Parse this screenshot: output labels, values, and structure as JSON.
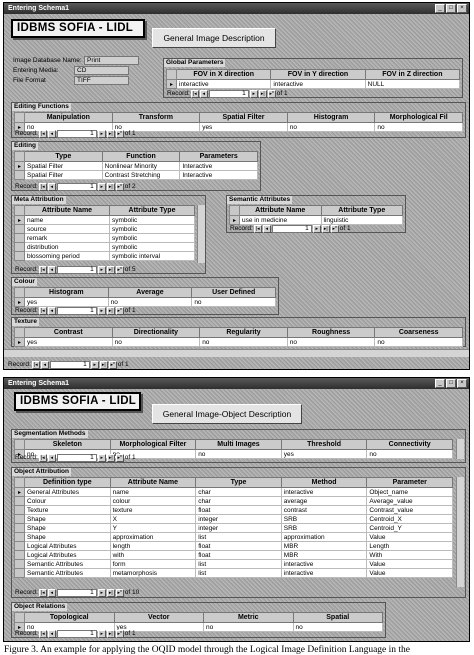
{
  "window1": {
    "title": "Entering Schema1",
    "logo": "IDBMS SOFIA - LIDL",
    "header_button": "General Image Description",
    "info": {
      "db_name_label": "Image Database Name:",
      "db_name_value": "Print",
      "media_label": "Entering Media:",
      "media_value": "CD",
      "format_label": "File Format",
      "format_value": "TIFF"
    },
    "global_params": {
      "title": "Global Parameters",
      "columns": [
        "FOV in X direction",
        "FOV in Y direction",
        "FOV in Z direction"
      ],
      "rows": [
        [
          "interactive",
          "interactive",
          "NULL"
        ]
      ],
      "record": "1",
      "of": "of 1"
    },
    "editing_functions": {
      "title": "Editing Functions",
      "columns": [
        "Manipulation",
        "Transform",
        "Spatial Filter",
        "Histogram",
        "Morphological Fil"
      ],
      "rows": [
        [
          "no",
          "no",
          "yes",
          "no",
          "no"
        ]
      ],
      "record": "1",
      "of": "of 1"
    },
    "editing": {
      "title": "Editing",
      "columns": [
        "Type",
        "Function",
        "Parameters"
      ],
      "rows": [
        [
          "Spatial Filter",
          "Nonlinear Minority",
          "Interactive"
        ],
        [
          "Spatial Filter",
          "Contrast Stretching",
          "Interactive"
        ]
      ],
      "record": "1",
      "of": "of 2"
    },
    "meta_attribution": {
      "title": "Meta Attribution",
      "columns": [
        "Attribute Name",
        "Attribute Type"
      ],
      "rows": [
        [
          "name",
          "symbolic"
        ],
        [
          "source",
          "symbolic"
        ],
        [
          "remark",
          "symbolic"
        ],
        [
          "distribution",
          "symbolic"
        ],
        [
          "blossoming period",
          "symbolic interval"
        ]
      ],
      "record": "1",
      "of": "of 5"
    },
    "semantic_attributes": {
      "title": "Semantic Attributes",
      "columns": [
        "Attribute Name",
        "Attribute Type"
      ],
      "rows": [
        [
          "use in medicine",
          "linguistic"
        ]
      ],
      "record": "1",
      "of": "of 1"
    },
    "colour": {
      "title": "Colour",
      "columns": [
        "Histogram",
        "Average",
        "User Defined"
      ],
      "rows": [
        [
          "yes",
          "no",
          "no"
        ]
      ],
      "record": "1",
      "of": "of 1"
    },
    "texture": {
      "title": "Texture",
      "columns": [
        "Contrast",
        "Directionality",
        "Regularity",
        "Roughness",
        "Coarseness"
      ],
      "rows": [
        [
          "yes",
          "no",
          "no",
          "no",
          "no"
        ]
      ]
    },
    "bottom_record": "1",
    "bottom_of": "of 1",
    "record_label": "Record:"
  },
  "window2": {
    "title": "Entering Schema1",
    "logo": "IDBMS SOFIA - LIDL",
    "header_button": "General Image-Object Description",
    "segmentation": {
      "title": "Segmentation Methods",
      "columns": [
        "Skeleton",
        "Morphological Filter",
        "Multi Images",
        "Threshold",
        "Connectivity"
      ],
      "rows": [
        [
          "no",
          "no",
          "no",
          "yes",
          "no"
        ]
      ],
      "record": "1",
      "of": "of 1"
    },
    "object_attribution": {
      "title": "Object Attribution",
      "columns": [
        "Definition type",
        "Attribute Name",
        "Type",
        "Method",
        "Parameter"
      ],
      "rows": [
        [
          "General Attributes",
          "name",
          "char",
          "interactive",
          "Object_name"
        ],
        [
          "Colour",
          "colour",
          "char",
          "average",
          "Average_value"
        ],
        [
          "Texture",
          "texture",
          "float",
          "contrast",
          "Contrast_value"
        ],
        [
          "Shape",
          "X",
          "integer",
          "SRB",
          "Centroid_X"
        ],
        [
          "Shape",
          "Y",
          "integer",
          "SRB",
          "Centroid_Y"
        ],
        [
          "Shape",
          "approximation",
          "list",
          "approximation",
          "Value"
        ],
        [
          "Logical Attributes",
          "length",
          "float",
          "MBR",
          "Length"
        ],
        [
          "Logical Attributes",
          "with",
          "float",
          "MBR",
          "With"
        ],
        [
          "Semantic Attributes",
          "form",
          "list",
          "interactive",
          "Value"
        ],
        [
          "Semantic Attributes",
          "metamorphosis",
          "list",
          "interactive",
          "Value"
        ]
      ],
      "record": "1",
      "of": "of 10"
    },
    "object_relations": {
      "title": "Object Relations",
      "columns": [
        "Topological",
        "Vector",
        "Metric",
        "Spatial"
      ],
      "rows": [
        [
          "no",
          "yes",
          "no",
          "no"
        ]
      ],
      "record": "1",
      "of": "of 1"
    }
  },
  "caption": "Figure 3. An example for applying the OQID model through the Logical Image Definition Language in the"
}
